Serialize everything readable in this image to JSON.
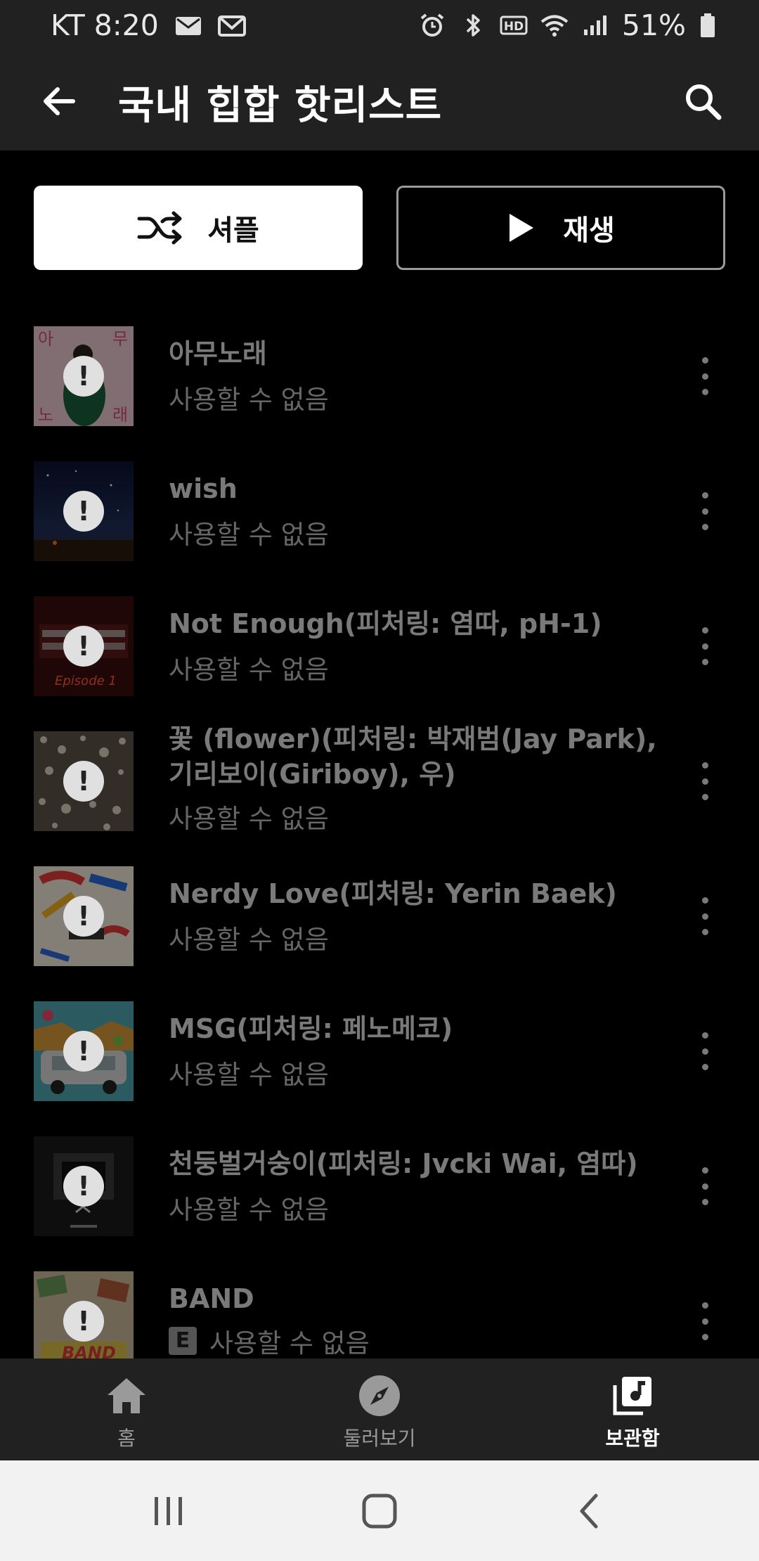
{
  "status_bar": {
    "carrier_time": "KT 8:20",
    "battery": "51%",
    "icons": [
      "mail-icon",
      "gmail-icon",
      "alarm-icon",
      "bluetooth-icon",
      "hd-icon",
      "wifi-icon",
      "signal-icon",
      "battery-icon"
    ]
  },
  "header": {
    "title": "국내 힙합 핫리스트"
  },
  "actions": {
    "shuffle_label": "셔플",
    "play_label": "재생"
  },
  "tracks": [
    {
      "title": "아무노래",
      "subtitle": "사용할 수 없음"
    },
    {
      "title": "wish",
      "subtitle": "사용할 수 없음"
    },
    {
      "title": "Not Enough(피처링: 염따, pH-1)",
      "subtitle": "사용할 수 없음"
    },
    {
      "title": "꽃 (flower)(피처링: 박재범(Jay Park), 기리보이(Giriboy), 우)",
      "subtitle": "사용할 수 없음"
    },
    {
      "title": "Nerdy Love(피처링: Yerin Baek)",
      "subtitle": "사용할 수 없음"
    },
    {
      "title": "MSG(피처링: 페노메코)",
      "subtitle": "사용할 수 없음"
    },
    {
      "title": "천둥벌거숭이(피처링: Jvcki Wai, 염따)",
      "subtitle": "사용할 수 없음"
    },
    {
      "title": "BAND",
      "subtitle": "사용할 수 없음",
      "explicit": "E"
    }
  ],
  "bottom_nav": {
    "home": "홈",
    "explore": "둘러보기",
    "library": "보관함",
    "active": "library"
  },
  "colors": {
    "background": "#000000",
    "bar": "#212121",
    "disabled_text": "#7a7a7a"
  }
}
